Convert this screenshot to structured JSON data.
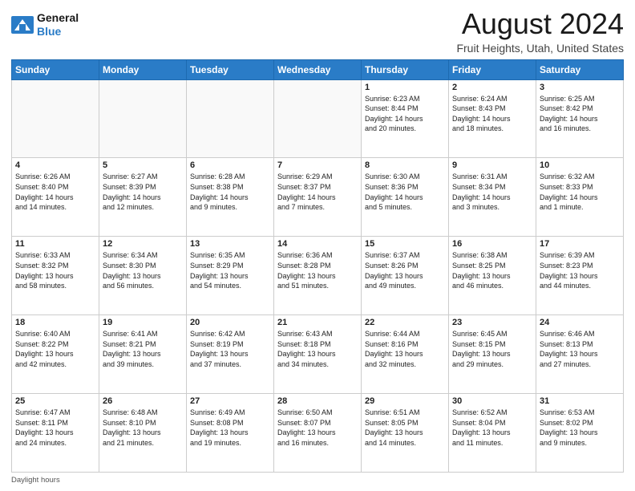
{
  "header": {
    "logo_line1": "General",
    "logo_line2": "Blue",
    "month": "August 2024",
    "location": "Fruit Heights, Utah, United States"
  },
  "days_of_week": [
    "Sunday",
    "Monday",
    "Tuesday",
    "Wednesday",
    "Thursday",
    "Friday",
    "Saturday"
  ],
  "weeks": [
    [
      {
        "day": "",
        "info": ""
      },
      {
        "day": "",
        "info": ""
      },
      {
        "day": "",
        "info": ""
      },
      {
        "day": "",
        "info": ""
      },
      {
        "day": "1",
        "info": "Sunrise: 6:23 AM\nSunset: 8:44 PM\nDaylight: 14 hours\nand 20 minutes."
      },
      {
        "day": "2",
        "info": "Sunrise: 6:24 AM\nSunset: 8:43 PM\nDaylight: 14 hours\nand 18 minutes."
      },
      {
        "day": "3",
        "info": "Sunrise: 6:25 AM\nSunset: 8:42 PM\nDaylight: 14 hours\nand 16 minutes."
      }
    ],
    [
      {
        "day": "4",
        "info": "Sunrise: 6:26 AM\nSunset: 8:40 PM\nDaylight: 14 hours\nand 14 minutes."
      },
      {
        "day": "5",
        "info": "Sunrise: 6:27 AM\nSunset: 8:39 PM\nDaylight: 14 hours\nand 12 minutes."
      },
      {
        "day": "6",
        "info": "Sunrise: 6:28 AM\nSunset: 8:38 PM\nDaylight: 14 hours\nand 9 minutes."
      },
      {
        "day": "7",
        "info": "Sunrise: 6:29 AM\nSunset: 8:37 PM\nDaylight: 14 hours\nand 7 minutes."
      },
      {
        "day": "8",
        "info": "Sunrise: 6:30 AM\nSunset: 8:36 PM\nDaylight: 14 hours\nand 5 minutes."
      },
      {
        "day": "9",
        "info": "Sunrise: 6:31 AM\nSunset: 8:34 PM\nDaylight: 14 hours\nand 3 minutes."
      },
      {
        "day": "10",
        "info": "Sunrise: 6:32 AM\nSunset: 8:33 PM\nDaylight: 14 hours\nand 1 minute."
      }
    ],
    [
      {
        "day": "11",
        "info": "Sunrise: 6:33 AM\nSunset: 8:32 PM\nDaylight: 13 hours\nand 58 minutes."
      },
      {
        "day": "12",
        "info": "Sunrise: 6:34 AM\nSunset: 8:30 PM\nDaylight: 13 hours\nand 56 minutes."
      },
      {
        "day": "13",
        "info": "Sunrise: 6:35 AM\nSunset: 8:29 PM\nDaylight: 13 hours\nand 54 minutes."
      },
      {
        "day": "14",
        "info": "Sunrise: 6:36 AM\nSunset: 8:28 PM\nDaylight: 13 hours\nand 51 minutes."
      },
      {
        "day": "15",
        "info": "Sunrise: 6:37 AM\nSunset: 8:26 PM\nDaylight: 13 hours\nand 49 minutes."
      },
      {
        "day": "16",
        "info": "Sunrise: 6:38 AM\nSunset: 8:25 PM\nDaylight: 13 hours\nand 46 minutes."
      },
      {
        "day": "17",
        "info": "Sunrise: 6:39 AM\nSunset: 8:23 PM\nDaylight: 13 hours\nand 44 minutes."
      }
    ],
    [
      {
        "day": "18",
        "info": "Sunrise: 6:40 AM\nSunset: 8:22 PM\nDaylight: 13 hours\nand 42 minutes."
      },
      {
        "day": "19",
        "info": "Sunrise: 6:41 AM\nSunset: 8:21 PM\nDaylight: 13 hours\nand 39 minutes."
      },
      {
        "day": "20",
        "info": "Sunrise: 6:42 AM\nSunset: 8:19 PM\nDaylight: 13 hours\nand 37 minutes."
      },
      {
        "day": "21",
        "info": "Sunrise: 6:43 AM\nSunset: 8:18 PM\nDaylight: 13 hours\nand 34 minutes."
      },
      {
        "day": "22",
        "info": "Sunrise: 6:44 AM\nSunset: 8:16 PM\nDaylight: 13 hours\nand 32 minutes."
      },
      {
        "day": "23",
        "info": "Sunrise: 6:45 AM\nSunset: 8:15 PM\nDaylight: 13 hours\nand 29 minutes."
      },
      {
        "day": "24",
        "info": "Sunrise: 6:46 AM\nSunset: 8:13 PM\nDaylight: 13 hours\nand 27 minutes."
      }
    ],
    [
      {
        "day": "25",
        "info": "Sunrise: 6:47 AM\nSunset: 8:11 PM\nDaylight: 13 hours\nand 24 minutes."
      },
      {
        "day": "26",
        "info": "Sunrise: 6:48 AM\nSunset: 8:10 PM\nDaylight: 13 hours\nand 21 minutes."
      },
      {
        "day": "27",
        "info": "Sunrise: 6:49 AM\nSunset: 8:08 PM\nDaylight: 13 hours\nand 19 minutes."
      },
      {
        "day": "28",
        "info": "Sunrise: 6:50 AM\nSunset: 8:07 PM\nDaylight: 13 hours\nand 16 minutes."
      },
      {
        "day": "29",
        "info": "Sunrise: 6:51 AM\nSunset: 8:05 PM\nDaylight: 13 hours\nand 14 minutes."
      },
      {
        "day": "30",
        "info": "Sunrise: 6:52 AM\nSunset: 8:04 PM\nDaylight: 13 hours\nand 11 minutes."
      },
      {
        "day": "31",
        "info": "Sunrise: 6:53 AM\nSunset: 8:02 PM\nDaylight: 13 hours\nand 9 minutes."
      }
    ]
  ],
  "footer": {
    "note": "Daylight hours"
  }
}
